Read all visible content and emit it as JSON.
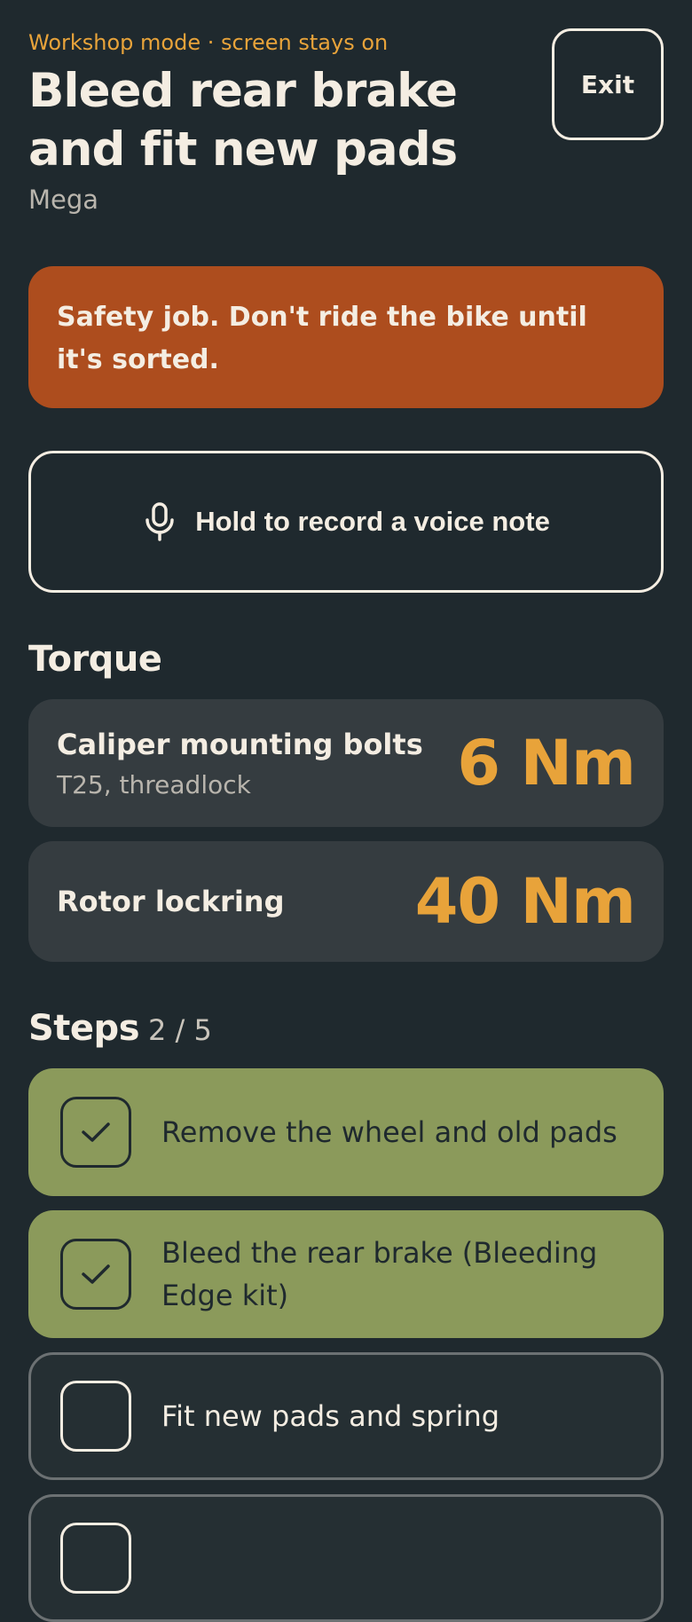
{
  "header": {
    "kicker": "Workshop mode · screen stays on",
    "title": "Bleed rear brake and fit new pads",
    "subtitle": "Mega",
    "exit_label": "Exit"
  },
  "alert": {
    "text": "Safety job. Don't ride the bike until it's sorted."
  },
  "voice_note": {
    "label": "Hold to record a voice note",
    "icon": "microphone-icon"
  },
  "torque": {
    "title": "Torque",
    "items": [
      {
        "name": "Caliper mounting bolts",
        "note": "T25, threadlock",
        "value": "6 Nm"
      },
      {
        "name": "Rotor lockring",
        "note": "",
        "value": "40 Nm"
      }
    ]
  },
  "steps": {
    "title": "Steps",
    "progress": "2 / 5",
    "items": [
      {
        "label": "Remove the wheel and old pads",
        "done": true
      },
      {
        "label": "Bleed the rear brake (Bleeding Edge kit)",
        "done": true
      },
      {
        "label": "Fit new pads and spring",
        "done": false
      },
      {
        "label": "",
        "done": false
      }
    ]
  },
  "colors": {
    "background": "#1f292e",
    "accent": "#e8a33a",
    "alert": "#ad4d1e",
    "done_step": "#8b9a5b",
    "card": "#353c40"
  }
}
